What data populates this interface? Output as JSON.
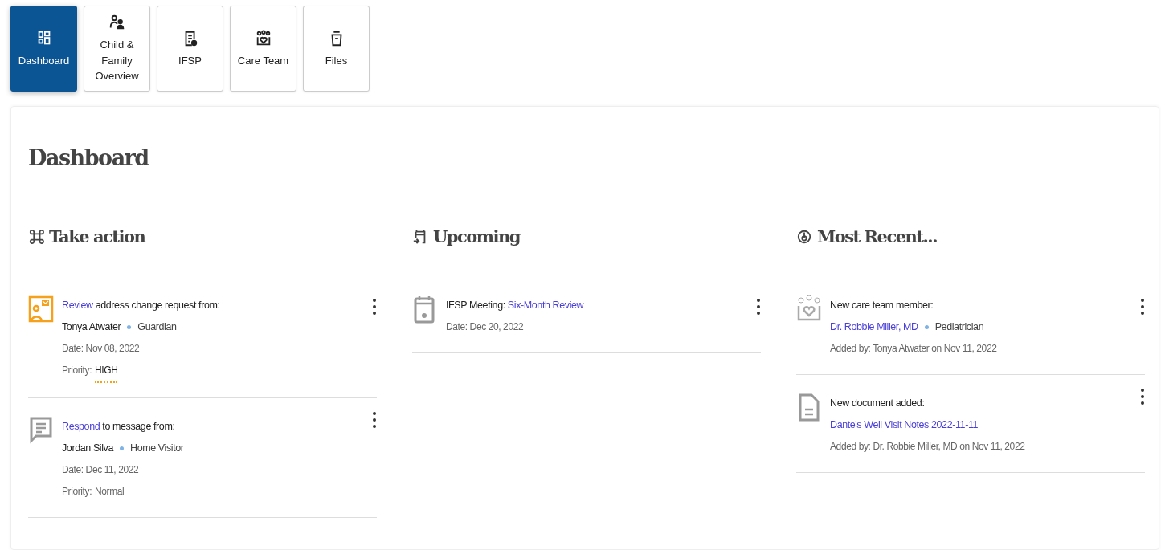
{
  "tabs": [
    {
      "label": "Dashboard",
      "selected": true
    },
    {
      "label": "Child & Family Overview",
      "selected": false
    },
    {
      "label": "IFSP",
      "selected": false
    },
    {
      "label": "Care Team",
      "selected": false
    },
    {
      "label": "Files",
      "selected": false
    }
  ],
  "page_title": "Dashboard",
  "sections": [
    {
      "kind": "action",
      "title": "Take action",
      "items": [
        {
          "kind": "address",
          "heading": [
            {
              "text": "Review",
              "link": true
            },
            {
              "text": " address change request from:",
              "link": false
            }
          ],
          "who": {
            "text": "Tonya Atwater",
            "link": false
          },
          "role": "Guardian",
          "meta": [
            "Date: Nov 08, 2022"
          ],
          "priority": {
            "label": "Priority:",
            "value": "HIGH",
            "urgent": true
          }
        },
        {
          "kind": "message",
          "heading": [
            {
              "text": "Respond",
              "link": true
            },
            {
              "text": " to message from:",
              "link": false
            }
          ],
          "who": {
            "text": "Jordan Silva",
            "link": false
          },
          "role": "Home Visitor",
          "meta": [
            "Date: Dec 11, 2022"
          ],
          "priority": {
            "label": "Priority:",
            "value": "Normal",
            "urgent": false
          }
        }
      ]
    },
    {
      "kind": "upcoming",
      "title": "Upcoming",
      "items": [
        {
          "kind": "event",
          "heading": [
            {
              "text": "IFSP Meeting: ",
              "link": false
            },
            {
              "text": "Six-Month Review",
              "link": true
            }
          ],
          "meta": [
            "Date: Dec 20, 2022"
          ]
        }
      ]
    },
    {
      "kind": "recent",
      "title": "Most Recent...",
      "items": [
        {
          "kind": "member",
          "heading": [
            {
              "text": "New care team member:",
              "link": false
            }
          ],
          "who": {
            "text": "Dr. Robbie Miller, MD",
            "link": true
          },
          "role": "Pediatrician",
          "meta": [
            "Added by: Tonya Atwater on Nov 11, 2022"
          ]
        },
        {
          "kind": "document",
          "heading": [
            {
              "text": "New document added:",
              "link": false
            }
          ],
          "who": {
            "text": "Dante's Well Visit Notes 2022-11-11",
            "link": true
          },
          "meta": [
            "Added by: Dr. Robbie Miller, MD on Nov 11, 2022"
          ]
        }
      ]
    }
  ]
}
